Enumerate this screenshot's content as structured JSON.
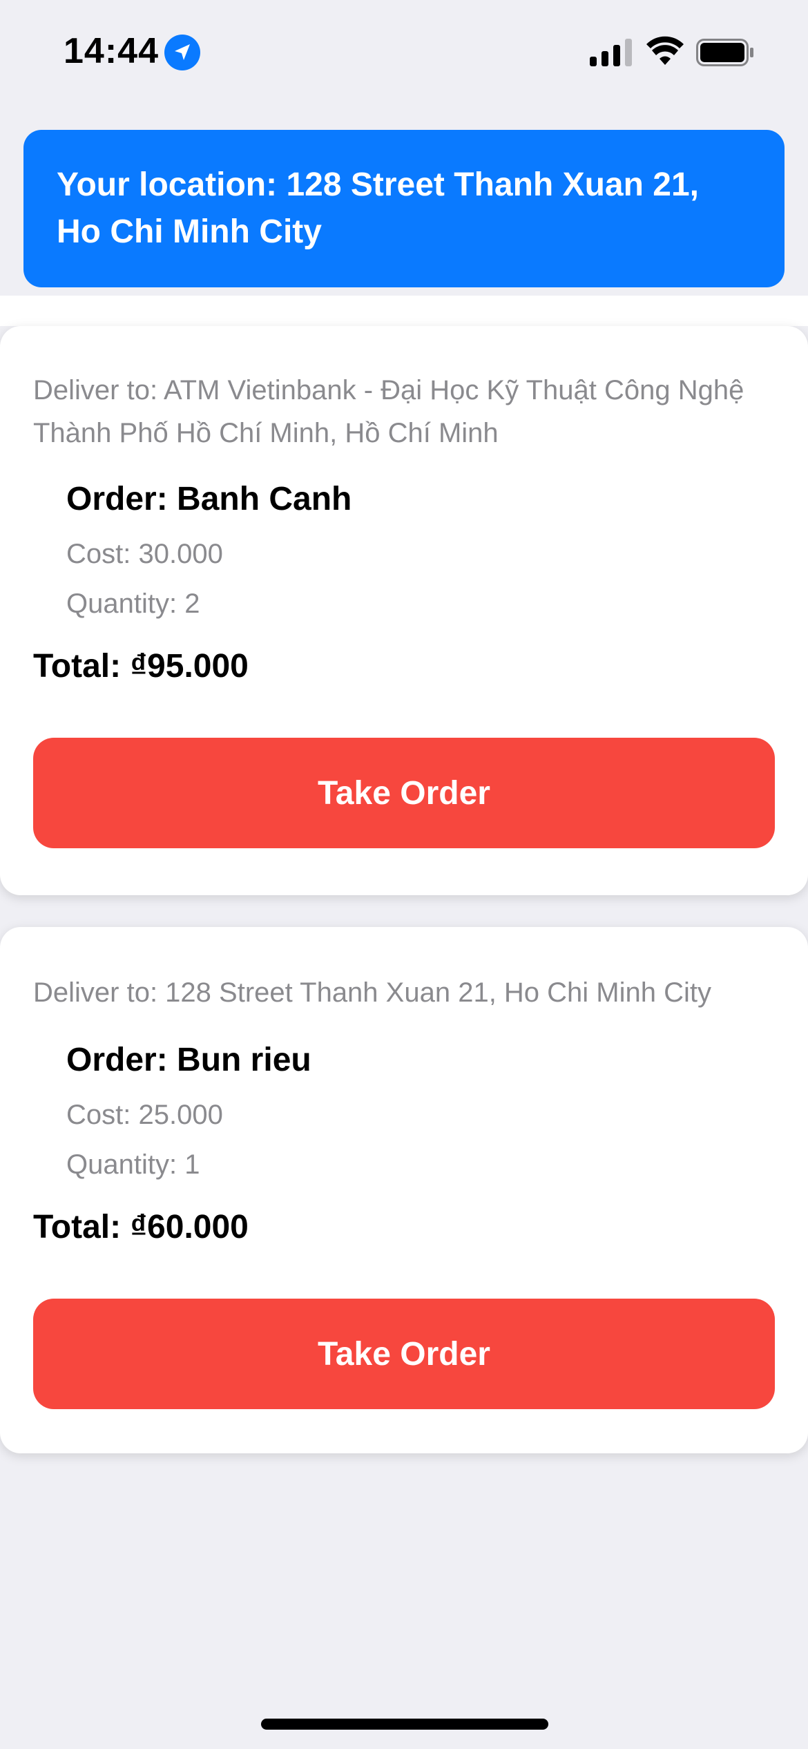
{
  "status_bar": {
    "time": "14:44",
    "icons": [
      "location-arrow-icon",
      "cellular-signal-icon",
      "wifi-icon",
      "battery-icon"
    ]
  },
  "location_banner": {
    "text": "Your location: 128 Street Thanh Xuan 21, Ho Chi Minh City"
  },
  "orders": [
    {
      "deliver_to": "Deliver to: ATM Vietinbank - Đại Học Kỹ Thuật Công Nghệ Thành Phố Hồ Chí Minh, Hồ Chí Minh",
      "order": "Order: Banh Canh",
      "cost": "Cost: 30.000",
      "quantity": "Quantity: 2",
      "total": "Total: ₫95.000",
      "button_label": "Take Order"
    },
    {
      "deliver_to": "Deliver to: 128 Street Thanh Xuan 21, Ho Chi Minh City",
      "order": "Order: Bun rieu",
      "cost": "Cost: 25.000",
      "quantity": "Quantity: 1",
      "total": "Total: ₫60.000",
      "button_label": "Take Order"
    }
  ],
  "colors": {
    "banner_blue": "#0a7aff",
    "button_red": "#f7473e",
    "background": "#efeff4",
    "secondary_text": "#8a8a8e"
  }
}
